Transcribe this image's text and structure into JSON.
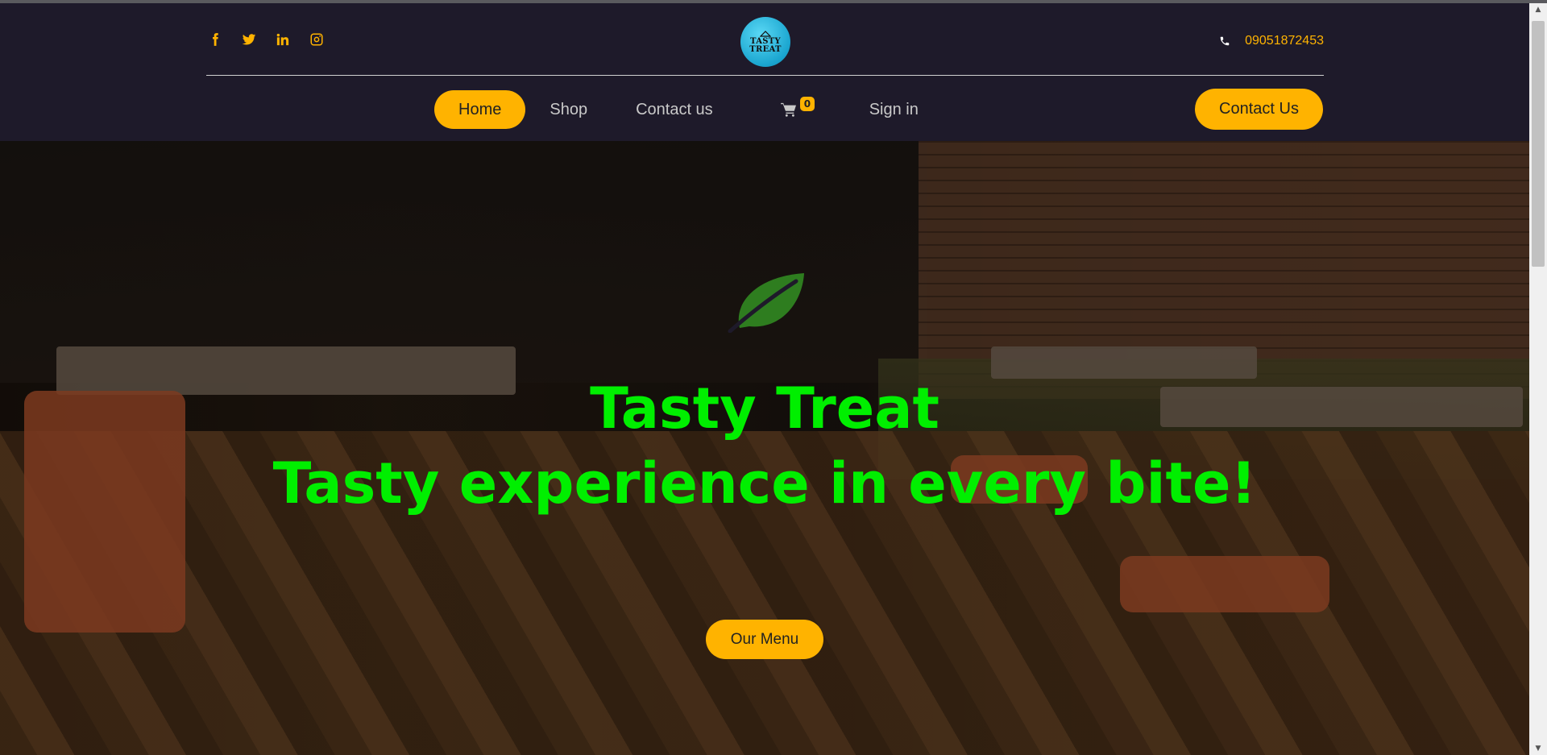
{
  "header": {
    "social": [
      {
        "icon": "facebook-icon"
      },
      {
        "icon": "twitter-icon"
      },
      {
        "icon": "linkedin-icon"
      },
      {
        "icon": "instagram-icon"
      }
    ],
    "logo": {
      "line1": "TASTY",
      "line2": "TREAT"
    },
    "phone": {
      "icon": "phone-icon",
      "number": "09051872453"
    },
    "nav": {
      "home": "Home",
      "shop": "Shop",
      "contact": "Contact us",
      "cart_count": "0",
      "signin": "Sign in"
    },
    "contact_button": "Contact Us"
  },
  "hero": {
    "title": "Tasty Treat",
    "subtitle": "Tasty experience in every bite!",
    "menu_button": "Our Menu",
    "leaf_icon": "leaf-icon"
  },
  "colors": {
    "accent": "#ffb300",
    "header_bg": "#1e1a2a",
    "hero_text": "#00ef00",
    "leaf": "#2e7d1f"
  }
}
